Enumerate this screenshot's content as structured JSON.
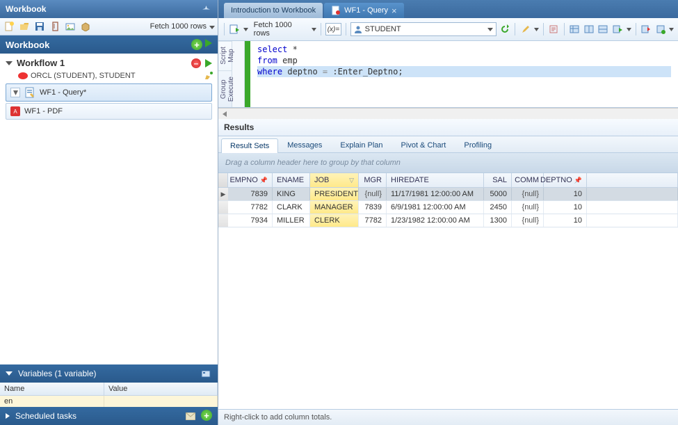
{
  "left": {
    "title": "Workbook",
    "fetch_label": "Fetch 1000 rows",
    "section_title": "Workbook",
    "workflow": {
      "name": "Workflow 1",
      "connection": "ORCL (STUDENT), STUDENT",
      "query_node": "WF1 - Query*",
      "pdf_node": "WF1 - PDF"
    },
    "variables_hdr": "Variables (1 variable)",
    "variables": {
      "name_col": "Name",
      "value_col": "Value",
      "rows": [
        {
          "name": "en",
          "value": ""
        }
      ]
    },
    "scheduled_hdr": "Scheduled tasks"
  },
  "tabs": {
    "intro": "Introduction to Workbook",
    "query": "WF1 - Query"
  },
  "toolbar": {
    "fetch_label": "Fetch 1000 rows",
    "fx": "(x)=",
    "connection": "STUDENT"
  },
  "side_tabs": {
    "script_map": "Script Map",
    "group_execute": "Group Execute"
  },
  "sql": {
    "line1_kw": "select",
    "line1_rest": " *",
    "line2_kw": "from",
    "line2_rest": " emp",
    "line3_kw": "where",
    "line3_col": " deptno ",
    "line3_op": "=",
    "line3_bind": " :Enter_Deptno",
    "line3_end": ";"
  },
  "results": {
    "header": "Results",
    "tabs": [
      "Result Sets",
      "Messages",
      "Explain Plan",
      "Pivot & Chart",
      "Profiling"
    ],
    "group_hint": "Drag a column header here to group by that column",
    "cols": {
      "empno": "EMPNO",
      "ename": "ENAME",
      "job": "JOB",
      "mgr": "MGR",
      "hiredate": "HIREDATE",
      "sal": "SAL",
      "comm": "COMM",
      "deptno": "DEPTNO"
    },
    "rows": [
      {
        "empno": "7839",
        "ename": "KING",
        "job": "PRESIDENT",
        "mgr": "{null}",
        "hiredate": "11/17/1981 12:00:00 AM",
        "sal": "5000",
        "comm": "{null}",
        "deptno": "10"
      },
      {
        "empno": "7782",
        "ename": "CLARK",
        "job": "MANAGER",
        "mgr": "7839",
        "hiredate": "6/9/1981 12:00:00 AM",
        "sal": "2450",
        "comm": "{null}",
        "deptno": "10"
      },
      {
        "empno": "7934",
        "ename": "MILLER",
        "job": "CLERK",
        "mgr": "7782",
        "hiredate": "1/23/1982 12:00:00 AM",
        "sal": "1300",
        "comm": "{null}",
        "deptno": "10"
      }
    ],
    "footer": "Right-click to add column totals."
  }
}
